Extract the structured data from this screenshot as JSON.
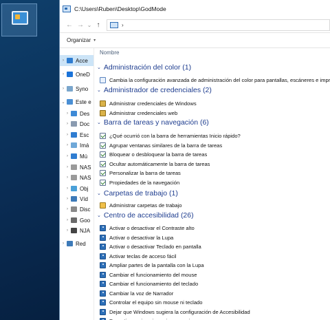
{
  "window": {
    "title": "C:\\Users\\Ruben\\Desktop\\GodMode"
  },
  "nav": {
    "back": "←",
    "forward": "→",
    "down": "⌄",
    "up": "↑",
    "address_sep": "›"
  },
  "toolbar": {
    "organize": "Organizar",
    "caret": "▾"
  },
  "sidebar": {
    "items": [
      {
        "label": "Acce",
        "color": "#2f7dd1",
        "selected": true,
        "chev": "›"
      },
      {
        "label": "OneD",
        "color": "#1a73d9",
        "selected": false,
        "chev": "›"
      },
      {
        "label": "Syno",
        "color": "#7aa6cc",
        "selected": false,
        "chev": "›"
      },
      {
        "label": "Este e",
        "color": "#4a8fd4",
        "selected": false,
        "chev": "⌄"
      },
      {
        "label": "Des",
        "color": "#3d8ad6",
        "selected": false,
        "chev": "›"
      },
      {
        "label": "Doc",
        "color": "#8a9bb0",
        "selected": false,
        "chev": "›"
      },
      {
        "label": "Esc",
        "color": "#2f7dd1",
        "selected": false,
        "chev": "›"
      },
      {
        "label": "Imá",
        "color": "#6fa8d8",
        "selected": false,
        "chev": "›"
      },
      {
        "label": "Mú",
        "color": "#2f7dd1",
        "selected": false,
        "chev": "›"
      },
      {
        "label": "NAS",
        "color": "#9a9a9a",
        "selected": false,
        "chev": "›"
      },
      {
        "label": "NAS",
        "color": "#9a9a9a",
        "selected": false,
        "chev": "›"
      },
      {
        "label": "Obj",
        "color": "#4aa0d8",
        "selected": false,
        "chev": "›"
      },
      {
        "label": "Víd",
        "color": "#3d7ab8",
        "selected": false,
        "chev": "›"
      },
      {
        "label": "Disc",
        "color": "#8a8a8a",
        "selected": false,
        "chev": "›"
      },
      {
        "label": "Goo",
        "color": "#6a6a6a",
        "selected": false,
        "chev": "›"
      },
      {
        "label": "NJA",
        "color": "#444444",
        "selected": false,
        "chev": "›"
      },
      {
        "label": "Red",
        "color": "#3d7ab8",
        "selected": false,
        "chev": "›"
      }
    ]
  },
  "content": {
    "column_header": "Nombre",
    "groups": [
      {
        "title": "Administración del color (1)",
        "icon": "color",
        "items": [
          "Cambia la configuración avanzada de administración del color para pantallas, escáneres e impre"
        ]
      },
      {
        "title": "Administrador de credenciales (2)",
        "icon": "cred",
        "items": [
          "Administrar credenciales de Windows",
          "Administrar credenciales web"
        ]
      },
      {
        "title": "Barra de tareas y navegación (6)",
        "icon": "task",
        "items": [
          "¿Qué ocurrió con la barra de herramientas Inicio rápido?",
          "Agrupar ventanas similares de la barra de tareas",
          "Bloquear o desbloquear la barra de tareas",
          "Ocultar automáticamente la barra de tareas",
          "Personalizar la barra de tareas",
          "Propiedades de la navegación"
        ]
      },
      {
        "title": "Carpetas de trabajo (1)",
        "icon": "work",
        "items": [
          "Administrar carpetas de trabajo"
        ]
      },
      {
        "title": "Centro de accesibilidad (26)",
        "icon": "acc",
        "items": [
          "Activar o desactivar el Contraste alto",
          "Activar o desactivar la Lupa",
          "Activar o desactivar Teclado en pantalla",
          "Activar teclas de acceso fácil",
          "Ampliar partes de la pantalla con la Lupa",
          "Cambiar el funcionamiento del mouse",
          "Cambiar el funcionamiento del teclado",
          "Cambiar la voz de Narrador",
          "Controlar el equipo sin mouse ni teclado",
          "Dejar que Windows sugiera la configuración de Accesibilidad",
          "Desactivar animaciones innecesarias"
        ]
      }
    ]
  }
}
